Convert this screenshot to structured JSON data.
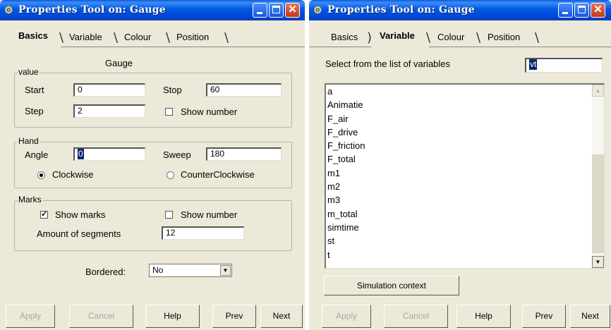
{
  "left": {
    "title": "Properties Tool on: Gauge",
    "tabs": [
      "Basics",
      "Variable",
      "Colour",
      "Position"
    ],
    "active_tab": "Basics",
    "heading": "Gauge",
    "value_group": {
      "legend": "value",
      "start_label": "Start",
      "start_value": "0",
      "stop_label": "Stop",
      "stop_value": "60",
      "step_label": "Step",
      "step_value": "2",
      "show_number_label": "Show number",
      "show_number_checked": false
    },
    "hand_group": {
      "legend": "Hand",
      "angle_label": "Angle",
      "angle_value": "0",
      "sweep_label": "Sweep",
      "sweep_value": "180",
      "clockwise_label": "Clockwise",
      "clockwise_selected": true,
      "counter_label": "CounterClockwise",
      "counter_selected": false
    },
    "marks_group": {
      "legend": "Marks",
      "show_marks_label": "Show marks",
      "show_marks_checked": true,
      "show_number_label": "Show number",
      "show_number_checked": false,
      "segments_label": "Amount of segments",
      "segments_value": "12"
    },
    "bordered_label": "Bordered:",
    "bordered_value": "No",
    "buttons": {
      "apply": "Apply",
      "cancel": "Cancel",
      "help": "Help",
      "prev": "Prev",
      "next": "Next"
    }
  },
  "right": {
    "title": "Properties Tool on: Gauge",
    "tabs": [
      "Basics",
      "Variable",
      "Colour",
      "Position"
    ],
    "active_tab": "Variable",
    "select_label": "Select from the list of variables",
    "variable_value": "vt",
    "variables": [
      "a",
      "Animatie",
      "F_air",
      "F_drive",
      "F_friction",
      "F_total",
      "m1",
      "m2",
      "m3",
      "m_total",
      "simtime",
      "st",
      "t"
    ],
    "scroll_position": 0.95,
    "simulation_button": "Simulation context",
    "buttons": {
      "apply": "Apply",
      "cancel": "Cancel",
      "help": "Help",
      "prev": "Prev",
      "next": "Next"
    }
  },
  "colors": {
    "titlebar": "#0058e6",
    "window": "#ece9d8",
    "close": "#d9502e"
  }
}
